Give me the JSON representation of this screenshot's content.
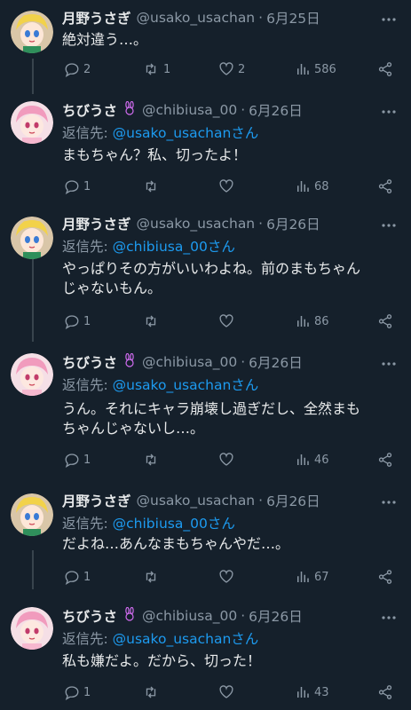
{
  "tweets": [
    {
      "name": "月野うさぎ",
      "handle": "@usako_usachan",
      "date": "6月25日",
      "reply_prefix": "",
      "reply_to": "",
      "text": [
        "絶対違う…。"
      ],
      "replies": "2",
      "retweets": "1",
      "likes": "2",
      "views": "586"
    },
    {
      "name": "ちびうさ",
      "handle": "@chibiusa_00",
      "date": "6月26日",
      "reply_prefix": "返信先: ",
      "reply_to": "@usako_usachanさん",
      "text": [
        "まもちゃん？私、切ったよ！"
      ],
      "replies": "1",
      "retweets": "",
      "likes": "",
      "views": "68"
    },
    {
      "name": "月野うさぎ",
      "handle": "@usako_usachan",
      "date": "6月26日",
      "reply_prefix": "返信先: ",
      "reply_to": "@chibiusa_00さん",
      "text": [
        "やっぱりその方がいいわよね。前のまもちゃん",
        "じゃないもん。"
      ],
      "replies": "1",
      "retweets": "",
      "likes": "",
      "views": "86"
    },
    {
      "name": "ちびうさ",
      "handle": "@chibiusa_00",
      "date": "6月26日",
      "reply_prefix": "返信先: ",
      "reply_to": "@usako_usachanさん",
      "text": [
        "うん。それにキャラ崩壊し過ぎだし、全然まも",
        "ちゃんじゃないし…。"
      ],
      "replies": "1",
      "retweets": "",
      "likes": "",
      "views": "46"
    },
    {
      "name": "月野うさぎ",
      "handle": "@usako_usachan",
      "date": "6月26日",
      "reply_prefix": "返信先: ",
      "reply_to": "@chibiusa_00さん",
      "text": [
        "だよね…あんなまもちゃんやだ…。"
      ],
      "replies": "1",
      "retweets": "",
      "likes": "",
      "views": "67"
    },
    {
      "name": "ちびうさ",
      "handle": "@chibiusa_00",
      "date": "6月26日",
      "reply_prefix": "返信先: ",
      "reply_to": "@usako_usachanさん",
      "text": [
        "私も嫌だよ。だから、切った！"
      ],
      "replies": "1",
      "retweets": "",
      "likes": "",
      "views": "43"
    }
  ],
  "colors": {
    "background": "#15202b",
    "text": "#e7e9ea",
    "secondary": "#8b98a5",
    "link": "#1d9bf0",
    "thread_line": "#38444d",
    "badge": "#d16cf0"
  },
  "icons": {
    "reply": "speech-bubble-icon",
    "retweet": "retweet-icon",
    "like": "heart-icon",
    "views": "bar-chart-icon",
    "share": "share-icon",
    "more": "ellipsis-icon",
    "badge": "bunny-icon"
  }
}
